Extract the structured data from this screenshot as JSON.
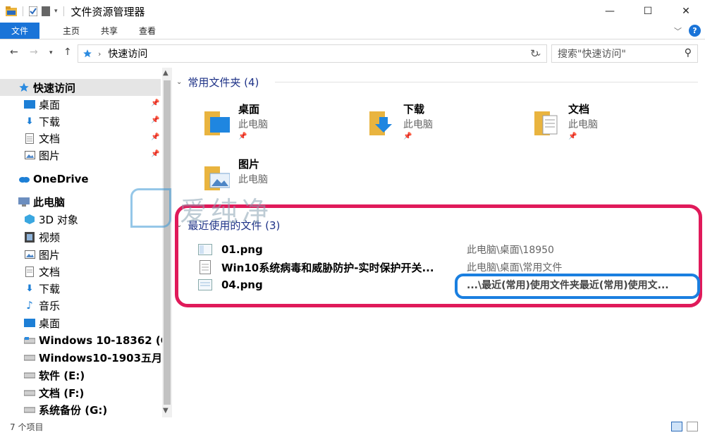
{
  "window": {
    "title": "文件资源管理器"
  },
  "ribbon": {
    "tabs": [
      "文件",
      "主页",
      "共享",
      "查看"
    ]
  },
  "address": {
    "path": "快速访问",
    "search_placeholder": "搜索\"快速访问\""
  },
  "sidebar": {
    "items": [
      {
        "label": "快速访问",
        "icon": "star-icon",
        "pinned": false,
        "selected": true
      },
      {
        "label": "桌面",
        "icon": "desktop-icon",
        "pinned": true
      },
      {
        "label": "下载",
        "icon": "download-icon",
        "pinned": true
      },
      {
        "label": "文档",
        "icon": "document-icon",
        "pinned": true
      },
      {
        "label": "图片",
        "icon": "pictures-icon",
        "pinned": true
      },
      {
        "label": "OneDrive",
        "icon": "cloud-icon"
      },
      {
        "label": "此电脑",
        "icon": "computer-icon"
      },
      {
        "label": "3D 对象",
        "icon": "cube-icon"
      },
      {
        "label": "视频",
        "icon": "video-icon"
      },
      {
        "label": "图片",
        "icon": "pictures-icon"
      },
      {
        "label": "文档",
        "icon": "document-icon"
      },
      {
        "label": "下载",
        "icon": "download-icon"
      },
      {
        "label": "音乐",
        "icon": "music-icon"
      },
      {
        "label": "桌面",
        "icon": "desktop-icon"
      },
      {
        "label": "Windows 10-18362 (C",
        "icon": "drive-icon"
      },
      {
        "label": "Windows10-1903五月",
        "icon": "drive-icon"
      },
      {
        "label": "软件 (E:)",
        "icon": "drive-icon"
      },
      {
        "label": "文档 (F:)",
        "icon": "drive-icon"
      },
      {
        "label": "系统备份 (G:)",
        "icon": "drive-icon"
      }
    ]
  },
  "frequent": {
    "header": "常用文件夹 (4)",
    "folders": [
      {
        "name": "桌面",
        "location": "此电脑",
        "icon": "desktop-folder-icon"
      },
      {
        "name": "下载",
        "location": "此电脑",
        "icon": "download-folder-icon"
      },
      {
        "name": "文档",
        "location": "此电脑",
        "icon": "documents-folder-icon"
      },
      {
        "name": "图片",
        "location": "此电脑",
        "icon": "pictures-folder-icon"
      }
    ]
  },
  "recent": {
    "header": "最近使用的文件 (3)",
    "files": [
      {
        "name": "01.png",
        "path": "此电脑\\桌面\\18950",
        "icon": "image-file-icon"
      },
      {
        "name": "Win10系统病毒和威胁防护-实时保护开关...",
        "path": "此电脑\\桌面\\常用文件",
        "icon": "text-file-icon"
      },
      {
        "name": "04.png",
        "path": "...\\最近(常用)使用文件夹最近(常用)使用文...",
        "icon": "image-file-icon"
      }
    ]
  },
  "watermark": {
    "text": "爱纯净"
  },
  "status": {
    "count": "7 个项目"
  },
  "colors": {
    "accent": "#1a74d8",
    "highlight_red": "#e01a5a",
    "highlight_blue": "#1a7fe0"
  }
}
